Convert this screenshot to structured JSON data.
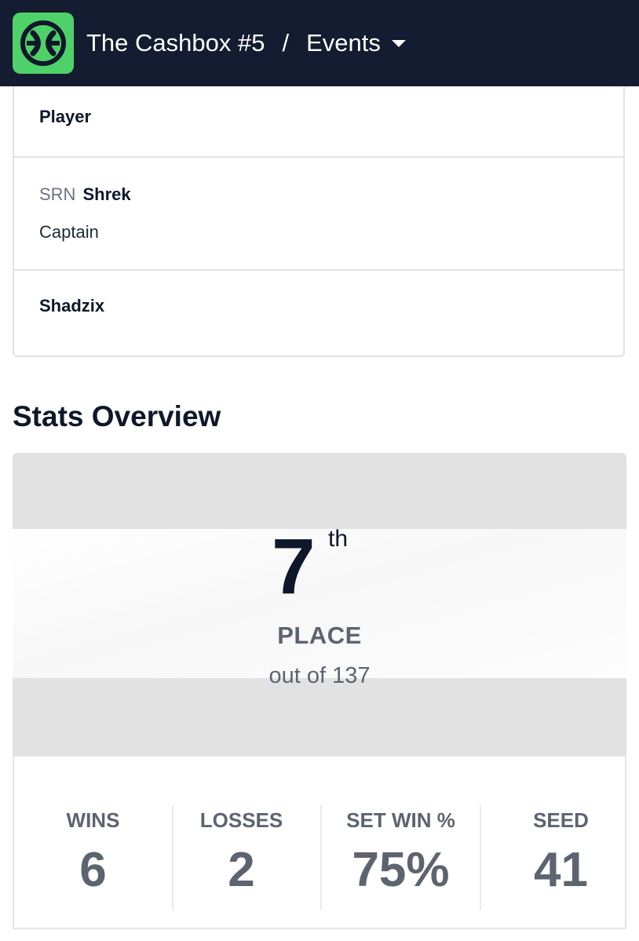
{
  "header": {
    "tournament": "The Cashbox #5",
    "separator": "/",
    "section": "Events",
    "brand_color": "#4fd16a",
    "bar_color": "#131c30"
  },
  "roster": {
    "rows": [
      {
        "name": "Player"
      },
      {
        "prefix": "SRN",
        "name": "Shrek",
        "role": "Captain"
      },
      {
        "name": "Shadzix"
      }
    ]
  },
  "stats": {
    "title": "Stats Overview",
    "place": {
      "number": "7",
      "suffix": "th",
      "label": "PLACE",
      "out_of": "out of 137"
    },
    "boxes": [
      {
        "label": "WINS",
        "value": "6"
      },
      {
        "label": "LOSSES",
        "value": "2"
      },
      {
        "label": "SET WIN %",
        "value": "75%"
      },
      {
        "label": "SEED",
        "value": "41"
      }
    ]
  },
  "icons": {
    "logo": "start-gg-logo-icon",
    "dropdown": "caret-down-icon"
  }
}
